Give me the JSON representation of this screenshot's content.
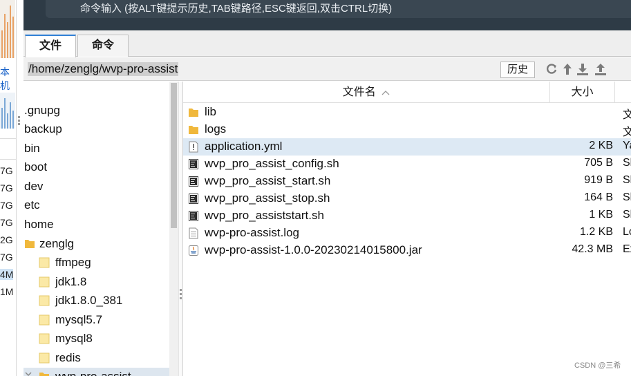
{
  "left_panel": {
    "label_machine": "本机",
    "values": [
      "7G",
      "7G",
      "7G",
      "7G",
      "2G",
      "7G",
      "4M",
      "1M"
    ]
  },
  "command": {
    "placeholder": "命令输入 (按ALT键提示历史,TAB键路径,ESC键返回,双击CTRL切换)"
  },
  "tabs": [
    {
      "label": "文件",
      "active": true
    },
    {
      "label": "命令",
      "active": false
    }
  ],
  "path": {
    "value": "/home/zenglg/wvp-pro-assist",
    "history_label": "历史"
  },
  "toolbar_icons": [
    "refresh-icon",
    "up-icon",
    "download-icon",
    "upload-icon"
  ],
  "tree": {
    "items": [
      {
        "label": ".gnupg",
        "level": 0,
        "folder": false
      },
      {
        "label": "backup",
        "level": 0,
        "folder": false
      },
      {
        "label": "bin",
        "level": 0,
        "folder": false
      },
      {
        "label": "boot",
        "level": 0,
        "folder": false
      },
      {
        "label": "dev",
        "level": 0,
        "folder": false
      },
      {
        "label": "etc",
        "level": 0,
        "folder": false
      },
      {
        "label": "home",
        "level": 0,
        "folder": false
      },
      {
        "label": "zenglg",
        "level": 1,
        "folder": true
      },
      {
        "label": "ffmpeg",
        "level": 2,
        "folder": true
      },
      {
        "label": "jdk1.8",
        "level": 2,
        "folder": true
      },
      {
        "label": "jdk1.8.0_381",
        "level": 2,
        "folder": true
      },
      {
        "label": "mysql5.7",
        "level": 2,
        "folder": true
      },
      {
        "label": "mysql8",
        "level": 2,
        "folder": true
      },
      {
        "label": "redis",
        "level": 2,
        "folder": true
      },
      {
        "label": "wvp-pro-assist",
        "level": 2,
        "folder": true,
        "selected": true
      }
    ]
  },
  "file_list": {
    "headers": {
      "name": "文件名",
      "size": "大小"
    },
    "rows": [
      {
        "name": "lib",
        "size": "",
        "type": "文",
        "icon": "folder-icon"
      },
      {
        "name": "logs",
        "size": "",
        "type": "文",
        "icon": "folder-icon"
      },
      {
        "name": "application.yml",
        "size": "2 KB",
        "type": "Ya",
        "icon": "yml-file-icon",
        "selected": true
      },
      {
        "name": "wvp_pro_assist_config.sh",
        "size": "705 B",
        "type": "Sh",
        "icon": "script-file-icon"
      },
      {
        "name": "wvp_pro_assist_start.sh",
        "size": "919 B",
        "type": "Sh",
        "icon": "script-file-icon"
      },
      {
        "name": "wvp_pro_assist_stop.sh",
        "size": "164 B",
        "type": "Sh",
        "icon": "script-file-icon"
      },
      {
        "name": "wvp_pro_assiststart.sh",
        "size": "1 KB",
        "type": "Sh",
        "icon": "script-file-icon"
      },
      {
        "name": "wvp-pro-assist.log",
        "size": "1.2 KB",
        "type": "Lo",
        "icon": "text-file-icon"
      },
      {
        "name": "wvp-pro-assist-1.0.0-20230214015800.jar",
        "size": "42.3 MB",
        "type": "Ex",
        "icon": "java-jar-icon"
      }
    ]
  },
  "watermark": "CSDN @三希"
}
